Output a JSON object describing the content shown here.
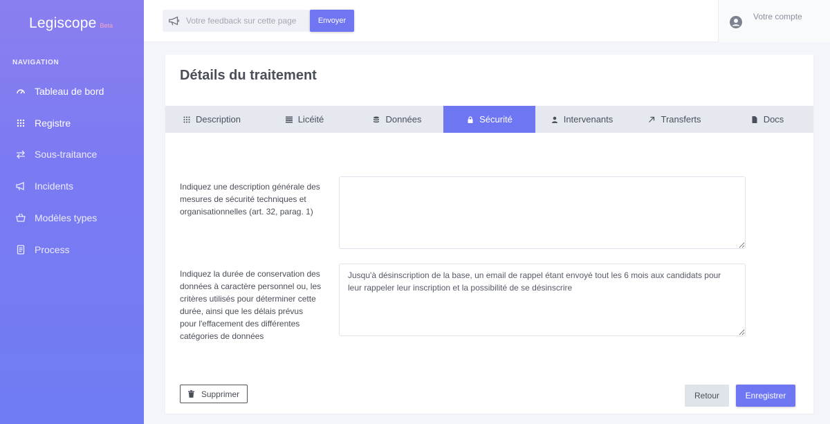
{
  "brand": {
    "name": "Legiscope",
    "tag": "Beta"
  },
  "sidebar": {
    "section_title": "NAVIGATION",
    "items": [
      {
        "label": "Tableau de bord",
        "icon": "dashboard-gauge-icon",
        "active": true
      },
      {
        "label": "Registre",
        "icon": "grid-dots-icon",
        "active": true
      },
      {
        "label": "Sous-traitance",
        "icon": "exchange-arrows-icon",
        "active": false
      },
      {
        "label": "Incidents",
        "icon": "megaphone-icon",
        "active": false
      },
      {
        "label": "Modèles types",
        "icon": "basket-icon",
        "active": false
      },
      {
        "label": "Process",
        "icon": "document-icon",
        "active": false
      }
    ]
  },
  "topbar": {
    "feedback_placeholder": "Votre feedback sur cette page",
    "feedback_value": "",
    "send_label": "Envoyer",
    "account_label": "Votre compte"
  },
  "page": {
    "title": "Détails du traitement",
    "tabs": [
      {
        "label": "Description",
        "icon": "grid-dots-icon",
        "active": false
      },
      {
        "label": "Licéité",
        "icon": "list-icon",
        "active": false
      },
      {
        "label": "Données",
        "icon": "database-icon",
        "active": false
      },
      {
        "label": "Sécurité",
        "icon": "lock-icon",
        "active": true
      },
      {
        "label": "Intervenants",
        "icon": "user-icon",
        "active": false
      },
      {
        "label": "Transferts",
        "icon": "arrow-up-right-icon",
        "active": false
      },
      {
        "label": "Docs",
        "icon": "file-icon",
        "active": false
      }
    ],
    "fields": [
      {
        "label": "Indiquez une description générale des mesures de sécurité techniques et organisationnelles (art. 32, parag. 1)",
        "value": ""
      },
      {
        "label": "Indiquez la durée de conservation des données à caractère personnel ou, les critères utilisés pour déterminer cette durée, ainsi que les délais prévus pour l'effacement des différentes catégories de données",
        "value": "Jusqu'à désinscription de la base, un email de rappel étant envoyé tout les 6 mois aux candidats pour leur rappeler leur inscription et la possibilité de se désinscrire"
      }
    ],
    "actions": {
      "delete_label": "Supprimer",
      "back_label": "Retour",
      "save_label": "Enregistrer"
    }
  },
  "colors": {
    "accent": "#6f76f2",
    "sidebar_top": "#8a7ff0",
    "sidebar_bottom": "#6f7cf3",
    "brand_tag": "#f7a8c4"
  }
}
